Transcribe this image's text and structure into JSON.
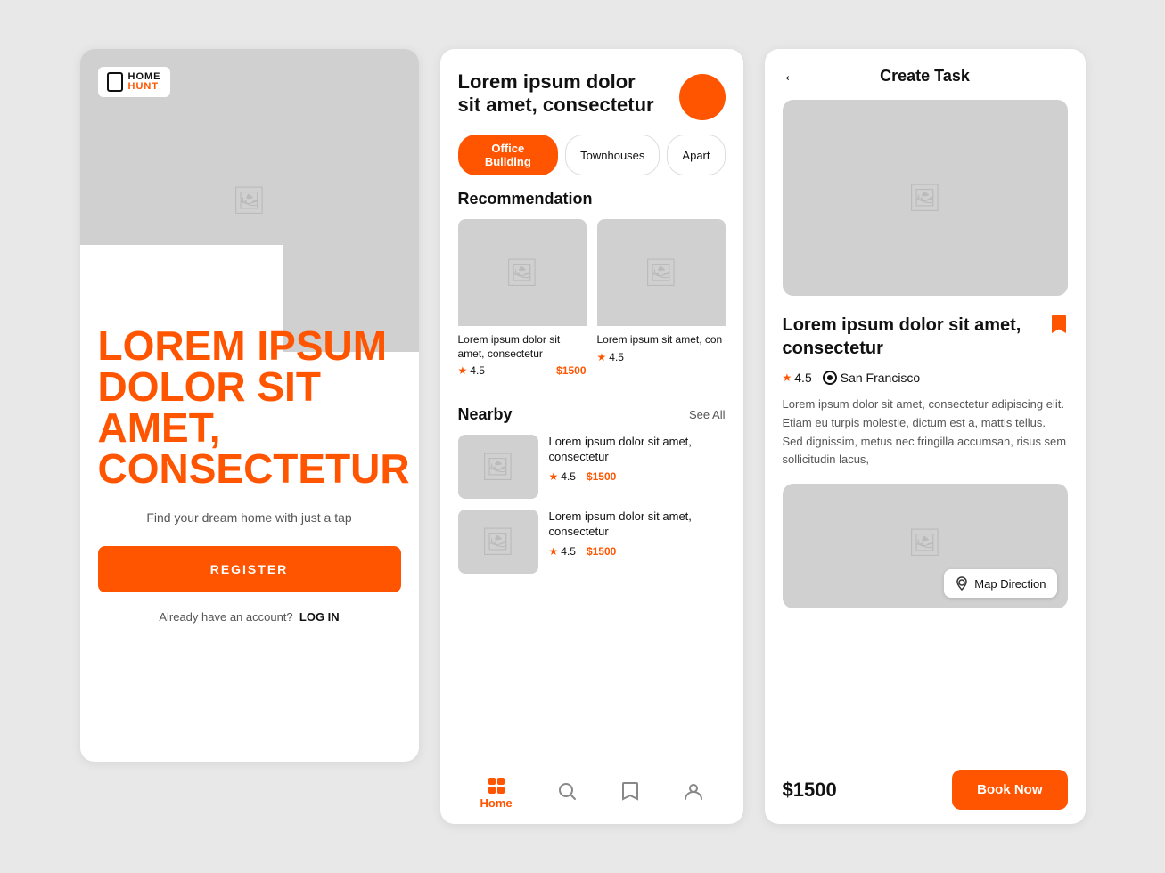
{
  "screen1": {
    "logo_home": "HOME",
    "logo_hunt": "HUNT",
    "headline": "LOREM IPSUM DOLOR SIT AMET, CONSECTETUR",
    "subtitle": "Find your dream home with just a tap",
    "register_btn": "REGISTER",
    "login_prompt": "Already have an account?",
    "login_link": "LOG IN"
  },
  "screen2": {
    "header_title": "Lorem ipsum dolor\nsit amet, consectetur",
    "tab_active": "Office Building",
    "tab_townhouses": "Townhouses",
    "tab_apart": "Apart",
    "recommendation_title": "Recommendation",
    "rec_items": [
      {
        "name": "Lorem ipsum dolor sit amet, consectetur",
        "rating": "4.5",
        "price": "$1500"
      },
      {
        "name": "Lorem ipsum sit amet, con",
        "rating": "4.5",
        "price": ""
      }
    ],
    "nearby_title": "Nearby",
    "see_all": "See All",
    "nearby_items": [
      {
        "name": "Lorem ipsum dolor sit amet, consectetur",
        "rating": "4.5",
        "price": "$1500"
      },
      {
        "name": "Lorem ipsum dolor sit amet, consectetur",
        "rating": "4.5",
        "price": "$1500"
      }
    ],
    "nav_home": "Home",
    "nav_search": "",
    "nav_bookmark": "",
    "nav_profile": ""
  },
  "screen3": {
    "page_title": "Create Task",
    "back_arrow": "←",
    "property_name": "Lorem ipsum dolor sit amet, consectetur",
    "bookmark": "🔖",
    "rating": "4.5",
    "location": "San Francisco",
    "description": "Lorem ipsum dolor sit amet, consectetur adipiscing elit. Etiam eu turpis molestie, dictum est a, mattis tellus. Sed dignissim, metus nec fringilla accumsan, risus sem sollicitudin lacus,",
    "map_direction": "Map Direction",
    "price": "$1500",
    "book_now": "Book Now"
  }
}
